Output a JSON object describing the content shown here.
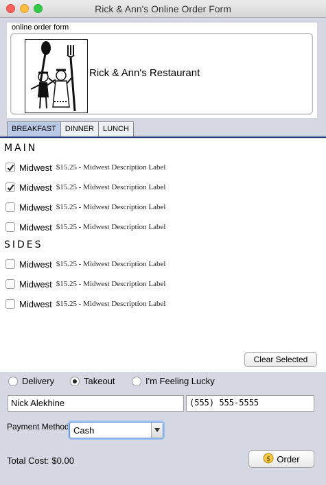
{
  "window": {
    "title": "Rick & Ann's Online Order Form"
  },
  "header": {
    "caption": "online order form",
    "restaurant_name": "Rick & Ann's Restaurant"
  },
  "tabs": [
    {
      "label": "BREAKFAST",
      "active": true
    },
    {
      "label": "DINNER",
      "active": false
    },
    {
      "label": "LUNCH",
      "active": false
    }
  ],
  "sections": {
    "main": {
      "title": "MAIN",
      "items": [
        {
          "name": "Midwest",
          "description": "$15.25 - Midwest Description Label",
          "checked": true
        },
        {
          "name": "Midwest",
          "description": "$15.25 - Midwest Description Label",
          "checked": true
        },
        {
          "name": "Midwest",
          "description": "$15.25 - Midwest Description Label",
          "checked": false
        },
        {
          "name": "Midwest",
          "description": "$15.25 - Midwest Description Label",
          "checked": false
        }
      ]
    },
    "sides": {
      "title": "SIDES",
      "items": [
        {
          "name": "Midwest",
          "description": "$15.25 - Midwest Description Label",
          "checked": false
        },
        {
          "name": "Midwest",
          "description": "$15.25 - Midwest Description Label",
          "checked": false
        },
        {
          "name": "Midwest",
          "description": "$15.25 - Midwest Description Label",
          "checked": false
        }
      ]
    }
  },
  "clear_button": "Clear Selected",
  "delivery_options": [
    {
      "label": "Delivery",
      "selected": false
    },
    {
      "label": "Takeout",
      "selected": true
    },
    {
      "label": "I'm Feeling Lucky",
      "selected": false
    }
  ],
  "customer": {
    "name": "Nick Alekhine",
    "phone": "(555) 555-5555"
  },
  "payment": {
    "label": "Payment Method",
    "selected": "Cash"
  },
  "total": {
    "label": "Total Cost:",
    "value": "$0.00"
  },
  "order_button": {
    "label": "Order",
    "icon": "dollar-icon"
  }
}
